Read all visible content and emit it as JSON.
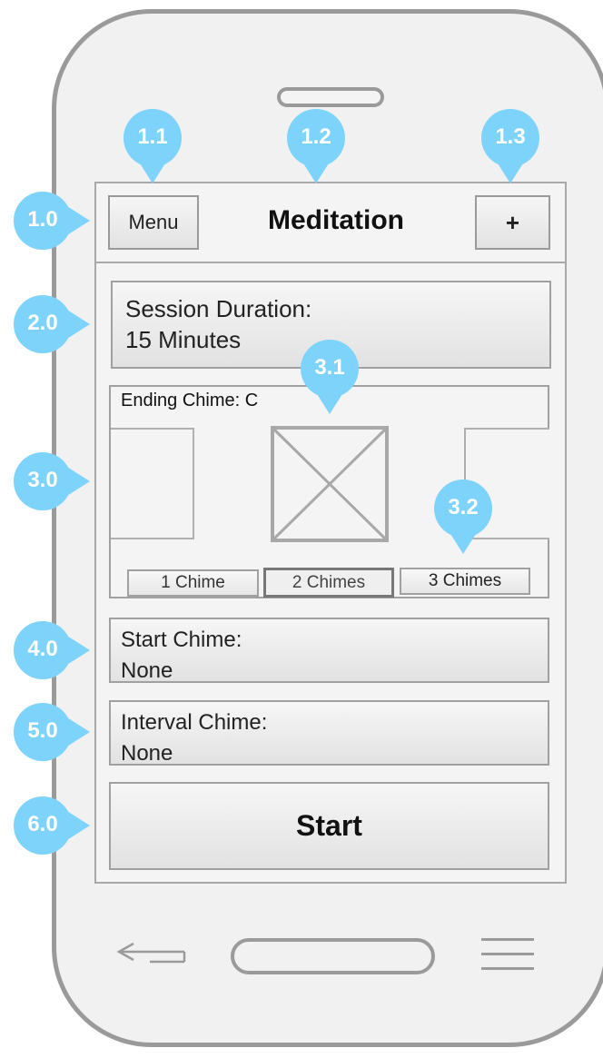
{
  "header": {
    "menu_label": "Menu",
    "title": "Meditation",
    "add_label": "+"
  },
  "session_duration": {
    "label": "Session Duration:",
    "value": "15 Minutes"
  },
  "ending_chime": {
    "label": "Ending Chime: C",
    "options": [
      "1 Chime",
      "2 Chimes",
      "3 Chimes"
    ],
    "selected": "2 Chimes"
  },
  "start_chime": {
    "label": "Start Chime:",
    "value": "None"
  },
  "interval_chime": {
    "label": "Interval Chime:",
    "value": "None"
  },
  "start_button": {
    "label": "Start"
  },
  "annotations": {
    "m1_0": "1.0",
    "m1_1": "1.1",
    "m1_2": "1.2",
    "m1_3": "1.3",
    "m2_0": "2.0",
    "m3_0": "3.0",
    "m3_1": "3.1",
    "m3_2": "3.2",
    "m4_0": "4.0",
    "m5_0": "5.0",
    "m6_0": "6.0"
  },
  "colors": {
    "annotation": "#7ed3fb",
    "phone_frame": "#9a9a9a",
    "screen_bg": "#f4f4f4"
  }
}
